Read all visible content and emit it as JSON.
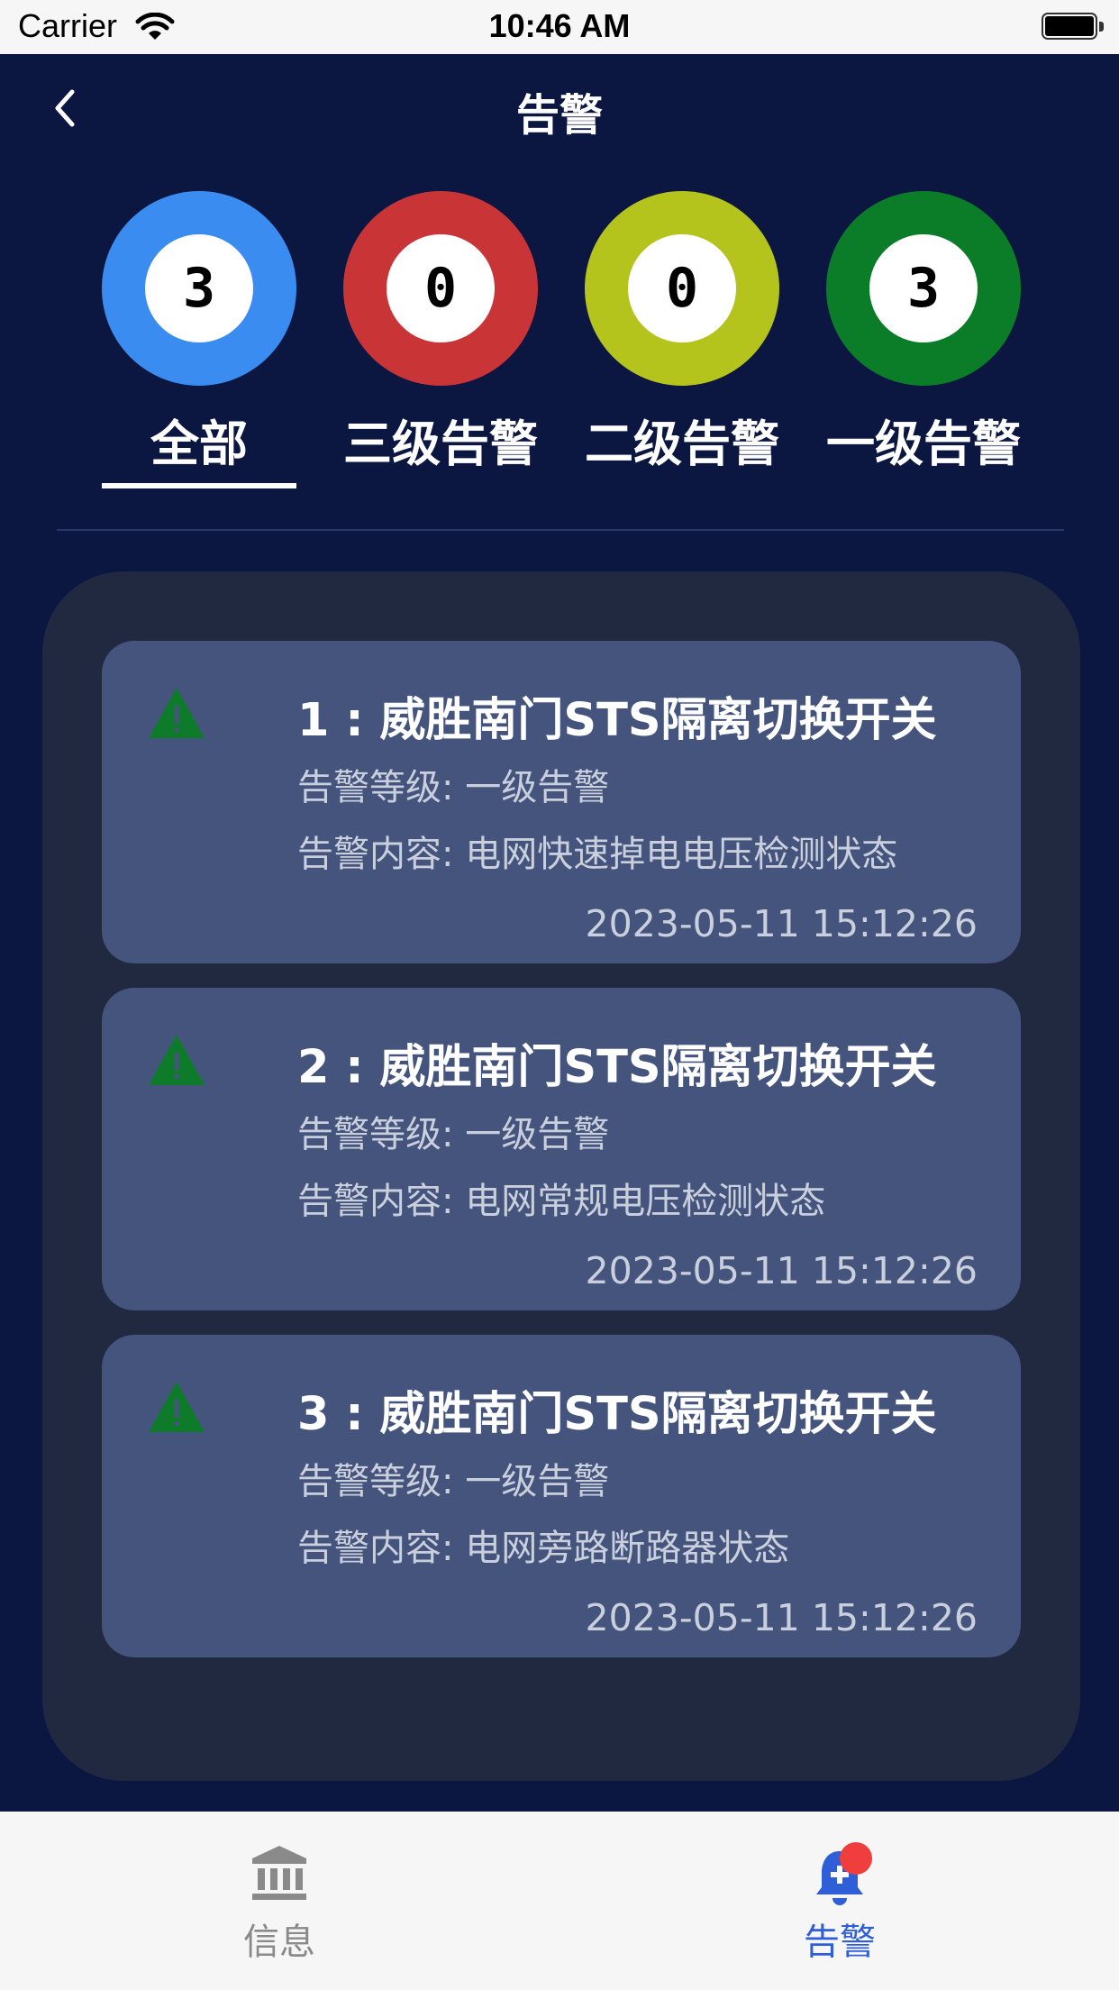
{
  "status_bar": {
    "carrier": "Carrier",
    "time": "10:46 AM"
  },
  "nav": {
    "title": "告警"
  },
  "filters": [
    {
      "count": "3",
      "label": "全部",
      "ring_color": "#3a8cf0",
      "selected": true
    },
    {
      "count": "0",
      "label": "三级告警",
      "ring_color": "#c93537",
      "selected": false
    },
    {
      "count": "0",
      "label": "二级告警",
      "ring_color": "#b5c41d",
      "selected": false
    },
    {
      "count": "3",
      "label": "一级告警",
      "ring_color": "#0b7d28",
      "selected": false
    }
  ],
  "alarms": [
    {
      "title": "1 : 威胜南门STS隔离切换开关",
      "level": "告警等级: 一级告警",
      "content": "告警内容: 电网快速掉电电压检测状态",
      "time": "2023-05-11 15:12:26",
      "icon": "warning-triangle-icon",
      "icon_color": "#0e7b2a"
    },
    {
      "title": "2 : 威胜南门STS隔离切换开关",
      "level": "告警等级: 一级告警",
      "content": "告警内容: 电网常规电压检测状态",
      "time": "2023-05-11 15:12:26",
      "icon": "warning-triangle-icon",
      "icon_color": "#0e7b2a"
    },
    {
      "title": "3 : 威胜南门STS隔离切换开关",
      "level": "告警等级: 一级告警",
      "content": "告警内容: 电网旁路断路器状态",
      "time": "2023-05-11 15:12:26",
      "icon": "warning-triangle-icon",
      "icon_color": "#0e7b2a"
    }
  ],
  "tab_bar": {
    "items": [
      {
        "label": "信息",
        "icon": "bank-icon",
        "active": false
      },
      {
        "label": "告警",
        "icon": "alarm-bell-icon",
        "active": true
      }
    ],
    "active_color": "#2f5fd8",
    "badge_color": "#f03e3e"
  }
}
